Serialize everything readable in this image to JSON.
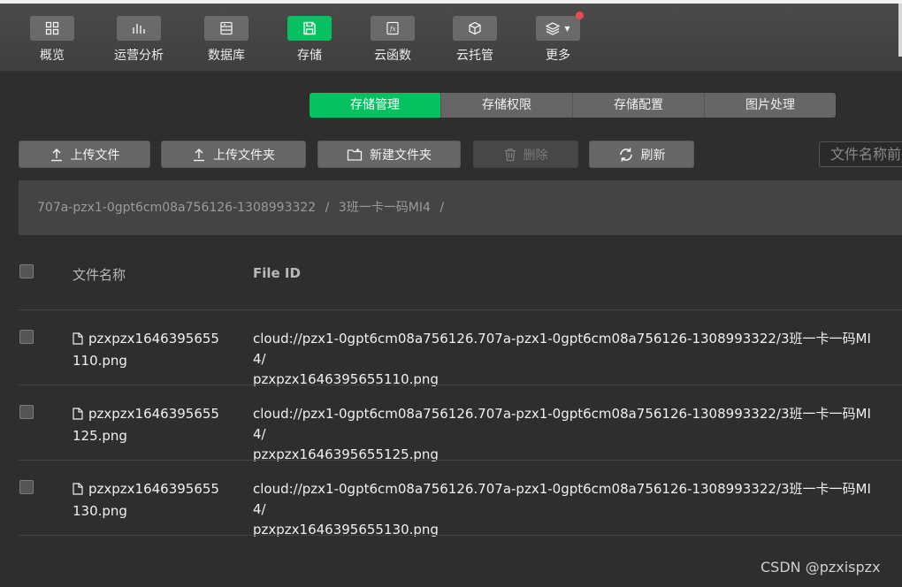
{
  "nav": {
    "items": [
      {
        "label": "概览",
        "icon": "grid-icon"
      },
      {
        "label": "运营分析",
        "icon": "bar-chart-icon"
      },
      {
        "label": "数据库",
        "icon": "database-icon"
      },
      {
        "label": "存储",
        "icon": "storage-icon",
        "active": true
      },
      {
        "label": "云函数",
        "icon": "function-icon"
      },
      {
        "label": "云托管",
        "icon": "cube-icon"
      },
      {
        "label": "更多",
        "icon": "layers-icon"
      }
    ]
  },
  "subtabs": [
    "存储管理",
    "存储权限",
    "存储配置",
    "图片处理"
  ],
  "actions": {
    "upload_file": "上传文件",
    "upload_folder": "上传文件夹",
    "new_folder": "新建文件夹",
    "delete": "删除",
    "refresh": "刷新"
  },
  "search": {
    "placeholder": "文件名称前"
  },
  "breadcrumb": {
    "bucket": "707a-pzx1-0gpt6cm08a756126-1308993322",
    "folder": "3班一卡一码MI4",
    "sep": "/"
  },
  "table": {
    "headers": {
      "name": "文件名称",
      "file_id": "File ID"
    },
    "rows": [
      {
        "name_line1": "pzxpzx1646395655",
        "name_line2": "110.png",
        "fid_line1": "cloud://pzx1-0gpt6cm08a756126.707a-pzx1-0gpt6cm08a756126-1308993322/3班一卡一码MI4/",
        "fid_line2": "pzxpzx1646395655110.png"
      },
      {
        "name_line1": "pzxpzx1646395655",
        "name_line2": "125.png",
        "fid_line1": "cloud://pzx1-0gpt6cm08a756126.707a-pzx1-0gpt6cm08a756126-1308993322/3班一卡一码MI4/",
        "fid_line2": "pzxpzx1646395655125.png"
      },
      {
        "name_line1": "pzxpzx1646395655",
        "name_line2": "130.png",
        "fid_line1": "cloud://pzx1-0gpt6cm08a756126.707a-pzx1-0gpt6cm08a756126-1308993322/3班一卡一码MI4/",
        "fid_line2": "pzxpzx1646395655130.png"
      }
    ]
  },
  "watermark": "CSDN @pzxispzx",
  "colors": {
    "accent": "#07c160",
    "background": "#2e2e2e",
    "notification": "#ec4a4a"
  }
}
